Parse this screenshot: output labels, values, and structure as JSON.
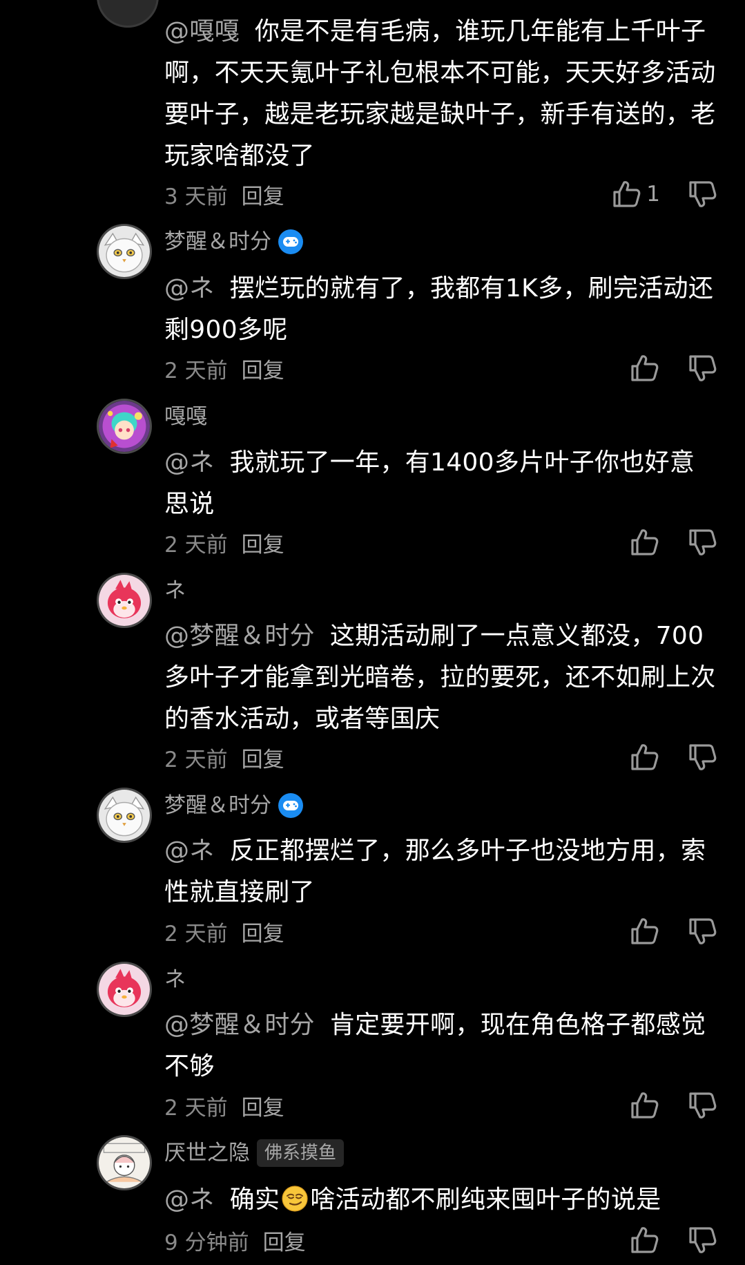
{
  "comments": [
    {
      "username": "",
      "mention": "@嘎嘎",
      "text": "你是不是有毛病，谁玩几年能有上千叶子啊，不天天氪叶子礼包根本不可能，天天好多活动要叶子，越是老玩家越是缺叶子，新手有送的，老玩家啥都没了",
      "time": "3 天前",
      "reply": "回复",
      "likes": "1",
      "avatar_icon": "",
      "badge": ""
    },
    {
      "username": "梦醒＆时分",
      "mention": "@ネ",
      "text": "摆烂玩的就有了，我都有1K多，刷完活动还剩900多呢",
      "time": "2 天前",
      "reply": "回复",
      "likes": "",
      "avatar_icon": "white-owl-avatar",
      "badge": "game-controller-badge"
    },
    {
      "username": "嘎嘎",
      "mention": "@ネ",
      "text": "我就玩了一年，有1400多片叶子你也好意思说",
      "time": "2 天前",
      "reply": "回复",
      "likes": "",
      "avatar_icon": "anime-girl-avatar",
      "badge": ""
    },
    {
      "username": "ネ",
      "mention": "@梦醒＆时分",
      "text": "这期活动刷了一点意义都没，700多叶子才能拿到光暗卷，拉的要死，还不如刷上次的香水活动，或者等国庆",
      "time": "2 天前",
      "reply": "回复",
      "likes": "",
      "avatar_icon": "red-bird-avatar",
      "badge": ""
    },
    {
      "username": "梦醒＆时分",
      "mention": "@ネ",
      "text": "反正都摆烂了，那么多叶子也没地方用，索性就直接刷了",
      "time": "2 天前",
      "reply": "回复",
      "likes": "",
      "avatar_icon": "white-owl-avatar",
      "badge": "game-controller-badge"
    },
    {
      "username": "ネ",
      "mention": "@梦醒＆时分",
      "text": "肯定要开啊，现在角色格子都感觉不够",
      "time": "2 天前",
      "reply": "回复",
      "likes": "",
      "avatar_icon": "red-bird-avatar",
      "badge": ""
    },
    {
      "username": "厌世之隐",
      "tag": "佛系摸鱼",
      "mention": "@ネ",
      "text_before": "确实",
      "emoji": "smirk-face-emoji",
      "text_after": "啥活动都不刷纯来囤叶子的说是",
      "time": "9 分钟前",
      "reply": "回复",
      "likes": "",
      "avatar_icon": "sketch-character-avatar",
      "badge": ""
    }
  ],
  "icons": {
    "like": "thumbs-up-icon",
    "dislike": "thumbs-down-icon"
  },
  "colors": {
    "background": "#000000",
    "text": "#ffffff",
    "secondary": "#a6a6a6",
    "badge_blue": "#1a8cf2"
  }
}
